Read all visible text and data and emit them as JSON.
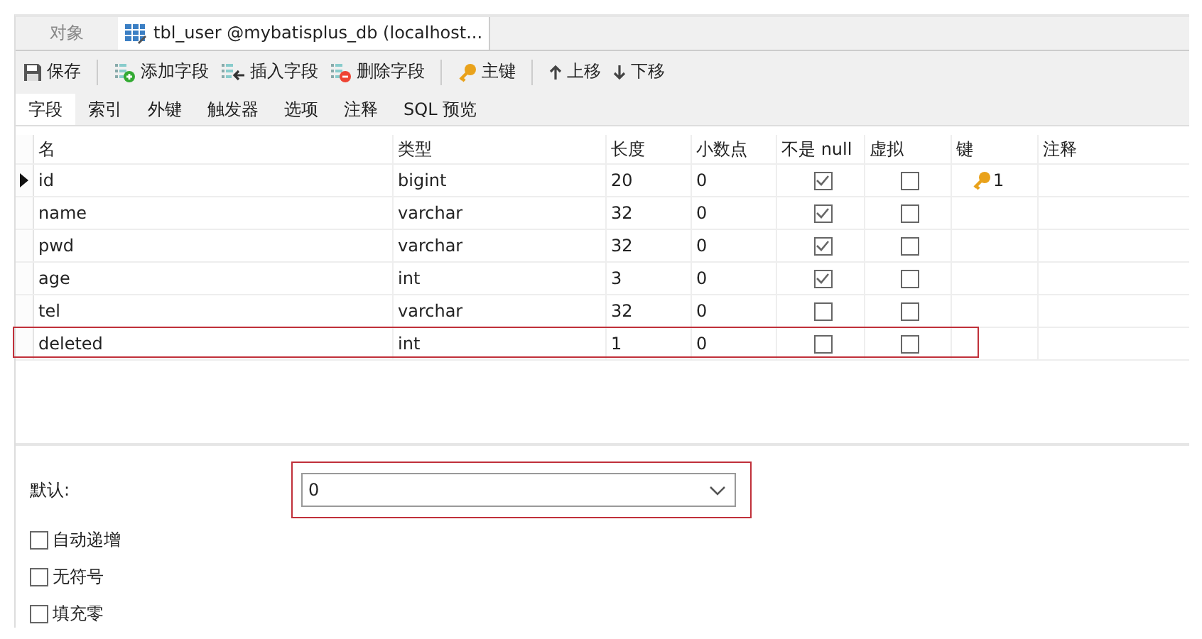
{
  "tabs": [
    {
      "label": "对象",
      "selected": false,
      "icon": false
    },
    {
      "label": "tbl_user @mybatisplus_db (localhost...",
      "selected": true,
      "icon": true
    }
  ],
  "toolbar": [
    [
      {
        "kind": "save",
        "label": "保存"
      }
    ],
    [
      {
        "kind": "add",
        "label": "添加字段"
      },
      {
        "kind": "insert",
        "label": "插入字段"
      },
      {
        "kind": "delete",
        "label": "删除字段"
      }
    ],
    [
      {
        "kind": "key",
        "label": "主键"
      }
    ],
    [
      {
        "kind": "up",
        "label": "上移"
      },
      {
        "kind": "down",
        "label": "下移"
      }
    ]
  ],
  "subtabs": [
    {
      "label": "字段",
      "selected": true
    },
    {
      "label": "索引",
      "selected": false
    },
    {
      "label": "外键",
      "selected": false
    },
    {
      "label": "触发器",
      "selected": false
    },
    {
      "label": "选项",
      "selected": false
    },
    {
      "label": "注释",
      "selected": false
    },
    {
      "label": "SQL 预览",
      "selected": false
    }
  ],
  "columns": [
    "名",
    "类型",
    "长度",
    "小数点",
    "不是 null",
    "虚拟",
    "键",
    "注释"
  ],
  "rows": [
    {
      "name": "id",
      "type": "bigint",
      "length": "20",
      "decimals": "0",
      "not_null": true,
      "virtual": false,
      "key": "1",
      "current": true,
      "highlighted": false
    },
    {
      "name": "name",
      "type": "varchar",
      "length": "32",
      "decimals": "0",
      "not_null": true,
      "virtual": false,
      "current": false,
      "highlighted": false
    },
    {
      "name": "pwd",
      "type": "varchar",
      "length": "32",
      "decimals": "0",
      "not_null": true,
      "virtual": false,
      "current": false,
      "highlighted": false
    },
    {
      "name": "age",
      "type": "int",
      "length": "3",
      "decimals": "0",
      "not_null": true,
      "virtual": false,
      "current": false,
      "highlighted": false
    },
    {
      "name": "tel",
      "type": "varchar",
      "length": "32",
      "decimals": "0",
      "not_null": false,
      "virtual": false,
      "current": false,
      "highlighted": false
    },
    {
      "name": "deleted",
      "type": "int",
      "length": "1",
      "decimals": "0",
      "not_null": false,
      "virtual": false,
      "current": false,
      "highlighted": true
    }
  ],
  "properties": {
    "default_label": "默认:",
    "default_value": "0",
    "default_highlighted": true,
    "options": [
      {
        "label": "自动递增",
        "checked": false
      },
      {
        "label": "无符号",
        "checked": false
      },
      {
        "label": "填充零",
        "checked": false
      }
    ]
  }
}
